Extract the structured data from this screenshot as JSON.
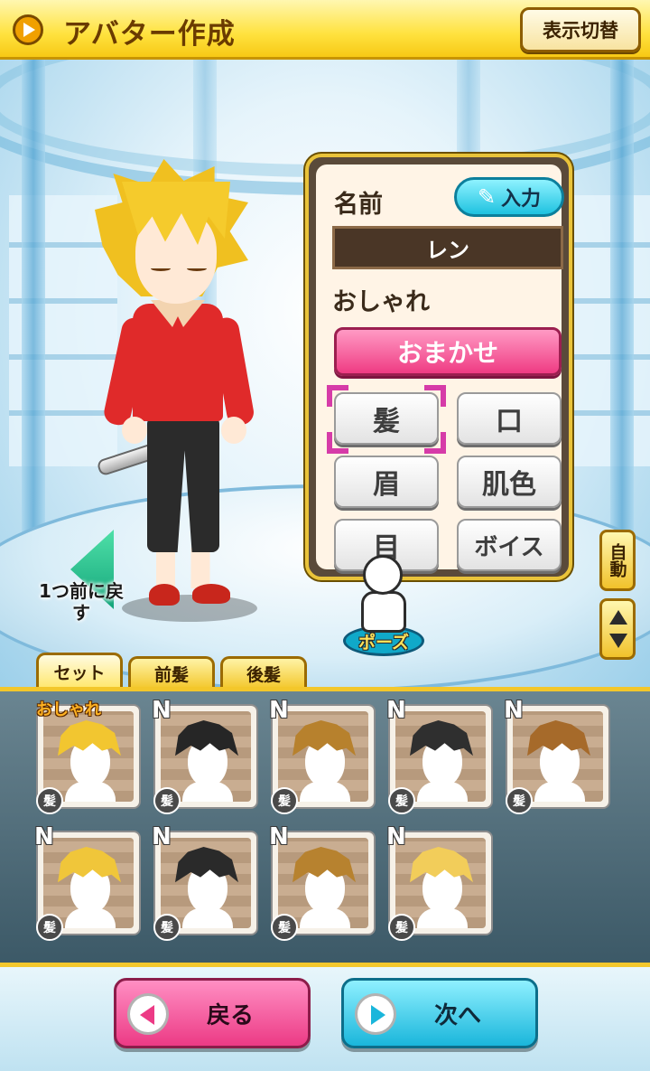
{
  "header": {
    "title": "アバター作成",
    "toggle_label": "表示切替"
  },
  "panel": {
    "name_label": "名前",
    "input_button": "入力",
    "name_value": "レン",
    "style_label": "おしゃれ",
    "random_button": "おまかせ",
    "parts": [
      "髪",
      "口",
      "眉",
      "肌色",
      "目",
      "ボイス"
    ],
    "selected_part": "髪"
  },
  "stage": {
    "back_one_label": "1つ前に戻す",
    "auto_label": "自動",
    "pose_label": "ポーズ"
  },
  "tabs": [
    "セット",
    "前髪",
    "後髪"
  ],
  "active_tab": "セット",
  "hair_cards": [
    {
      "tag": "おしゃれ",
      "rank": "",
      "badge": "髪",
      "color": "#f2c630"
    },
    {
      "tag": "",
      "rank": "N",
      "badge": "髪",
      "color": "#262626"
    },
    {
      "tag": "",
      "rank": "N",
      "badge": "髪",
      "color": "#b7812d"
    },
    {
      "tag": "",
      "rank": "N",
      "badge": "髪",
      "color": "#2f2f2f"
    },
    {
      "tag": "",
      "rank": "N",
      "badge": "髪",
      "color": "#a66a2a"
    },
    {
      "tag": "",
      "rank": "N",
      "badge": "髪",
      "color": "#f0c63a"
    },
    {
      "tag": "",
      "rank": "N",
      "badge": "髪",
      "color": "#2a2a2a"
    },
    {
      "tag": "",
      "rank": "N",
      "badge": "髪",
      "color": "#b7822f"
    },
    {
      "tag": "",
      "rank": "N",
      "badge": "髪",
      "color": "#f2cd5a"
    }
  ],
  "footer": {
    "back_label": "戻る",
    "next_label": "次へ"
  },
  "colors": {
    "accent_yellow": "#f3c72b",
    "random_pink": "#ef3b83",
    "next_cyan": "#1ab6db",
    "selection_magenta": "#d63ba8"
  }
}
